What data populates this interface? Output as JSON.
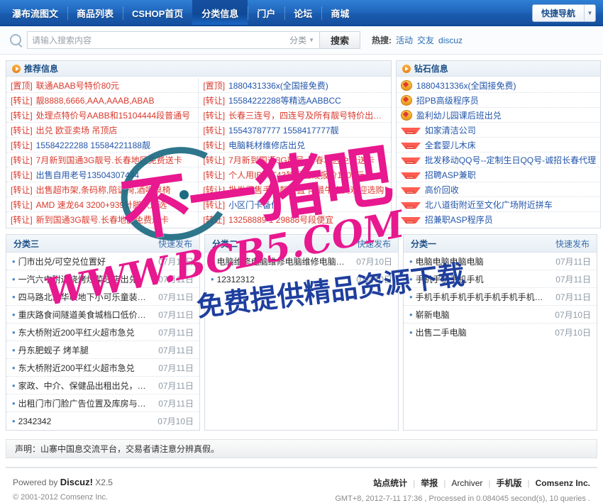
{
  "nav": {
    "items": [
      {
        "label": "瀑布流图文",
        "active": false
      },
      {
        "label": "商品列表",
        "active": false
      },
      {
        "label": "CSHOP首页",
        "active": false
      },
      {
        "label": "分类信息",
        "active": true
      },
      {
        "label": "门户",
        "active": false
      },
      {
        "label": "论坛",
        "active": false
      },
      {
        "label": "商城",
        "active": false
      }
    ],
    "quick_nav_label": "快捷导航",
    "accent_color": "#1a5cb0"
  },
  "search": {
    "placeholder": "请输入搜索内容",
    "value": "",
    "category_label": "分类",
    "button_label": "搜索",
    "hot_label": "热搜:",
    "hot_links": [
      "活动",
      "交友",
      "discuz"
    ]
  },
  "recommend_panel": {
    "title": "推荐信息",
    "left_rows": [
      {
        "tag": "[置顶]",
        "text": "联通ABAB号特价80元",
        "color": "red"
      },
      {
        "tag": "[转让]",
        "text": "靓8888,6666,AAA,AAAB,ABAB",
        "color": "red"
      },
      {
        "tag": "[转让]",
        "text": "处理点特价号AABB和15104444段普通号",
        "color": "red"
      },
      {
        "tag": "[转让]",
        "text": "出兑 欧亚卖场 吊顶店",
        "color": "red"
      },
      {
        "tag": "[转让]",
        "text": "15584222288 15584221188靓",
        "color": "blue"
      },
      {
        "tag": "[转让]",
        "text": "7月新到国通3G靓号.长春地区免费送卡",
        "color": "red"
      },
      {
        "tag": "[转让]",
        "text": "出售自用老号13504307444",
        "color": "blue"
      },
      {
        "tag": "[转让]",
        "text": "出售超市架,条码称,陪训椅,酒吧桌椅",
        "color": "red"
      },
      {
        "tag": "[转让]",
        "text": "AMD 速龙64 3200+939针脚欢迎选",
        "color": "red"
      },
      {
        "tag": "[转让]",
        "text": "新到国通3G靓号.长春地区免费送卡",
        "color": "red"
      }
    ],
    "right_rows": [
      {
        "tag": "[置顶]",
        "text": "1880431336x(全国接免费)",
        "color": "blue"
      },
      {
        "tag": "[转让]",
        "text": "15584222288等精选AABBCC",
        "color": "blue"
      },
      {
        "tag": "[转让]",
        "text": "长春三连号，四连号及所有靓号特价出售了",
        "color": "red"
      },
      {
        "tag": "[转让]",
        "text": "15543787777 1558417777靓",
        "color": "blue"
      },
      {
        "tag": "[转让]",
        "text": "电脑耗材维修店出兑",
        "color": "blue"
      },
      {
        "tag": "[转让]",
        "text": "7月新到国通3G靓号.长春地区免费送卡",
        "color": "red"
      },
      {
        "tag": "[转让]",
        "text": "个人用IBM T43独显无线报价1200元",
        "color": "red"
      },
      {
        "tag": "[转让]",
        "text": "批发零售手机靓号直卡 最牛资费欢迎选购",
        "color": "red"
      },
      {
        "tag": "[转让]",
        "text": "小区门卡备份",
        "color": "blue"
      },
      {
        "tag": "[转让]",
        "text": "13258889 1 29888号段便宜",
        "color": "red"
      }
    ]
  },
  "diamond_panel": {
    "title": "钻石信息",
    "rows": [
      {
        "icon": "medal-icon",
        "text": "1880431336x(全国接免费)"
      },
      {
        "icon": "medal-icon",
        "text": "招PB高级程序员"
      },
      {
        "icon": "medal-icon",
        "text": "盈利幼儿园课后班出兑"
      },
      {
        "icon": "gem-icon",
        "text": "如家清洁公司"
      },
      {
        "icon": "gem-icon",
        "text": "全套婴儿木床"
      },
      {
        "icon": "gem-icon",
        "text": "批发移动QQ号--定制生日QQ号-诚招长春代理"
      },
      {
        "icon": "gem-icon",
        "text": "招聘ASP兼职"
      },
      {
        "icon": "gem-icon",
        "text": "高价回收"
      },
      {
        "icon": "gem-icon",
        "text": "北八道街附近至文化广场附近拼车"
      },
      {
        "icon": "gem-icon",
        "text": "招兼职ASP程序员"
      }
    ]
  },
  "categories": [
    {
      "name": "分类三",
      "post_label": "快速发布",
      "rows": [
        {
          "title": "门市出兑/可空兑位置好",
          "date": "07月11日"
        },
        {
          "title": "一汽六中附近烧烤炒菜旺店出兑",
          "date": "07月11日"
        },
        {
          "title": "四马路北京华联地下小可乐童装急兑",
          "date": "07月11日"
        },
        {
          "title": "重庆路食间隧道美食城档口低价出兑",
          "date": "07月11日"
        },
        {
          "title": "东大桥附近200平红火超市急兑",
          "date": "07月11日"
        },
        {
          "title": "丹东肥蚬子 烤羊腿",
          "date": "07月11日"
        },
        {
          "title": "东大桥附近200平红火超市急兑",
          "date": "07月11日"
        },
        {
          "title": "家政、中介、保健品出租出兑，鲁辉国际城...",
          "date": "07月11日"
        },
        {
          "title": "出租门市门脸广告位置及库房与办公室，本...",
          "date": "07月11日"
        },
        {
          "title": "2342342",
          "date": "07月10日"
        }
      ]
    },
    {
      "name": "分类二",
      "post_label": "快速发布",
      "rows": [
        {
          "title": "电脑维修电脑维修电脑维修电脑维修电脑维...",
          "date": "07月10日"
        },
        {
          "title": "12312312",
          "date": "07月10日"
        }
      ]
    },
    {
      "name": "分类一",
      "post_label": "快速发布",
      "rows": [
        {
          "title": "电脑电脑电脑电脑",
          "date": "07月11日"
        },
        {
          "title": "手机手机手机手机",
          "date": "07月11日"
        },
        {
          "title": "手机手机手机手机手机手机手机手机手机手...",
          "date": "07月11日"
        },
        {
          "title": "崭新电脑",
          "date": "07月10日"
        },
        {
          "title": "出售二手电脑",
          "date": "07月10日"
        }
      ]
    }
  ],
  "declaration": "声明：山寨中国息交流平台，交易者请注意分辨真假。",
  "footer": {
    "powered_prefix": "Powered by",
    "powered_brand": "Discuz!",
    "powered_version": "X2.5",
    "copyright": "© 2001-2012 Comsenz Inc.",
    "links": [
      "站点统计",
      "举报",
      "Archiver",
      "手机版",
      "Comsenz Inc."
    ],
    "stats": "GMT+8, 2012-7-11 17:36 , Processed in 0.084045 second(s), 10 queries ."
  },
  "watermark": {
    "brand": "不一猪吧",
    "url": "WWW.BCB5.COM",
    "tagline": "免费提供精品资源下载",
    "pink": "#e8188f",
    "blue": "#1f3f9e"
  }
}
